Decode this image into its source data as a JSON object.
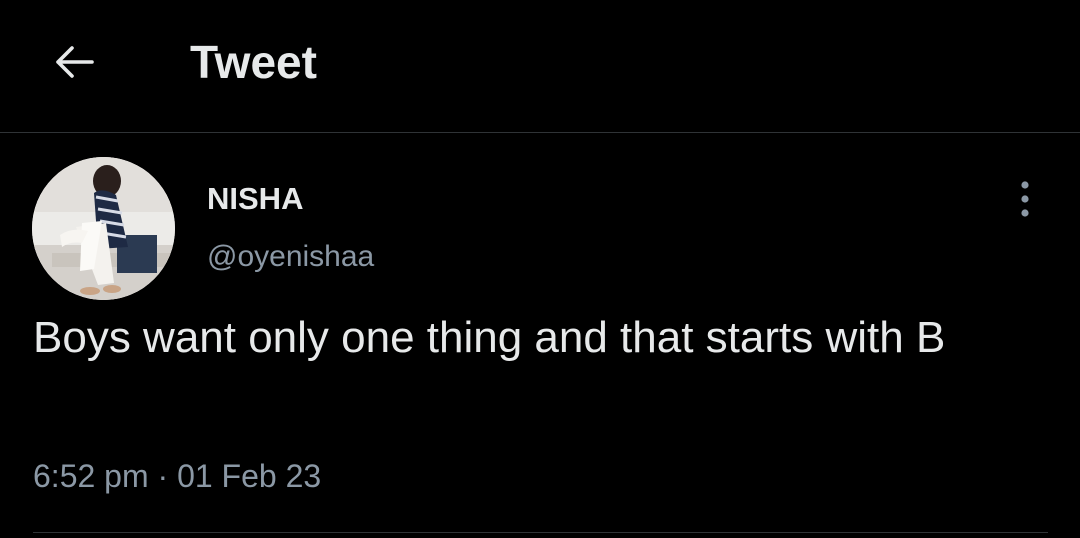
{
  "header": {
    "back_icon": "arrow-left-icon",
    "title": "Tweet"
  },
  "tweet": {
    "author": {
      "name": "NISHA",
      "handle": "@oyenishaa",
      "avatar": "profile-photo"
    },
    "more_icon": "more-vertical-icon",
    "text": "Boys want only one thing and that starts with B",
    "time": "6:52 pm",
    "separator": "·",
    "date": "01 Feb 23"
  },
  "colors": {
    "background": "#000000",
    "text_primary": "#e7e9ea",
    "text_secondary": "#8b98a5",
    "border": "#2f3336"
  }
}
